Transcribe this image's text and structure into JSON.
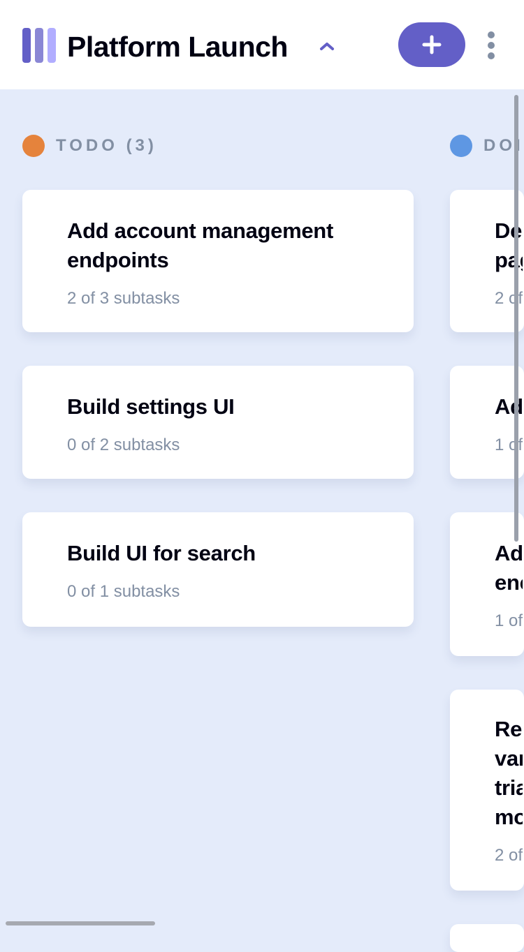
{
  "header": {
    "board_title": "Platform Launch",
    "logo_icon": "board-logo-icon",
    "chevron_icon": "chevron-up-icon",
    "add_button_icon": "plus-icon",
    "add_button_label": "+",
    "more_icon": "vertical-ellipsis-icon"
  },
  "colors": {
    "accent": "#635FC7",
    "accent_light": "#A8A4FF",
    "todo_dot": "#E5833C",
    "doing_dot": "#5E97E3",
    "text_dark": "#000112",
    "text_muted": "#828FA3",
    "background": "#E4EBFA"
  },
  "columns": [
    {
      "label": "TODO (3)",
      "cards": [
        {
          "title": "Add account management endpoints",
          "subtasks": "2 of 3 subtasks"
        },
        {
          "title": "Build settings UI",
          "subtasks": "0 of 2 subtasks"
        },
        {
          "title": "Build UI for search",
          "subtasks": "0 of 1 subtasks"
        }
      ]
    },
    {
      "label": "DOI",
      "cards": [
        {
          "title": "De pag",
          "subtasks": "2 of"
        },
        {
          "title": "Ad",
          "subtasks": "1 of"
        },
        {
          "title": "Ad enc",
          "subtasks": "1 of"
        },
        {
          "title": "Res var tria mo",
          "subtasks": "2 of"
        }
      ]
    }
  ]
}
